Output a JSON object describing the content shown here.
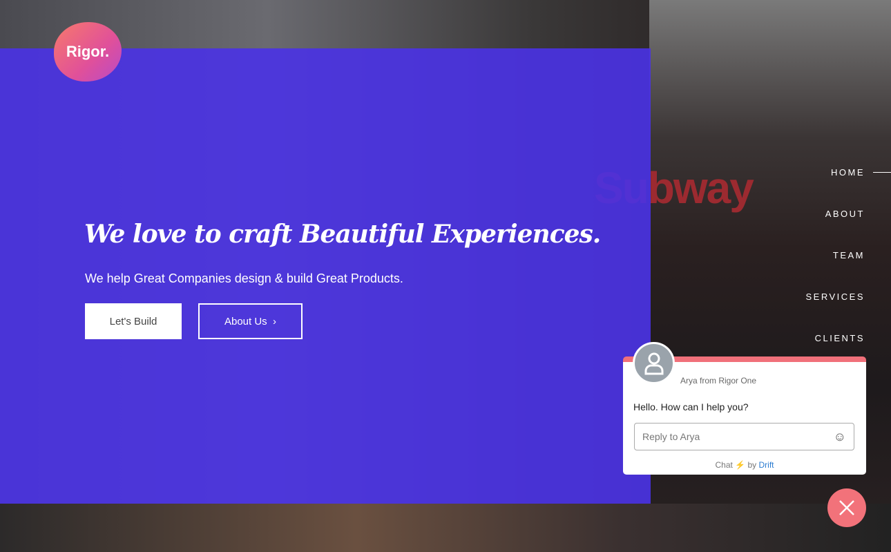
{
  "brand": {
    "logo_text": "Rigor."
  },
  "backdrop": {
    "sign_text": "Subway"
  },
  "hero": {
    "title": "We love to craft Beautiful Experiences.",
    "subtitle": "We help Great Companies design & build Great Products.",
    "primary_button": "Let's Build",
    "secondary_button": "About Us",
    "secondary_icon": "chevron-right"
  },
  "nav": {
    "items": [
      "HOME",
      "ABOUT",
      "TEAM",
      "SERVICES",
      "CLIENTS"
    ],
    "active": "HOME"
  },
  "chat": {
    "agent": "Arya from Rigor One",
    "message": "Hello. How can I help you?",
    "reply_placeholder": "Reply to Arya",
    "footer_chat": "Chat",
    "footer_by": "by",
    "footer_brand": "Drift",
    "accent": "#f0707a"
  },
  "colors": {
    "panel": "#4a32e6",
    "close_button": "#f2727a"
  }
}
